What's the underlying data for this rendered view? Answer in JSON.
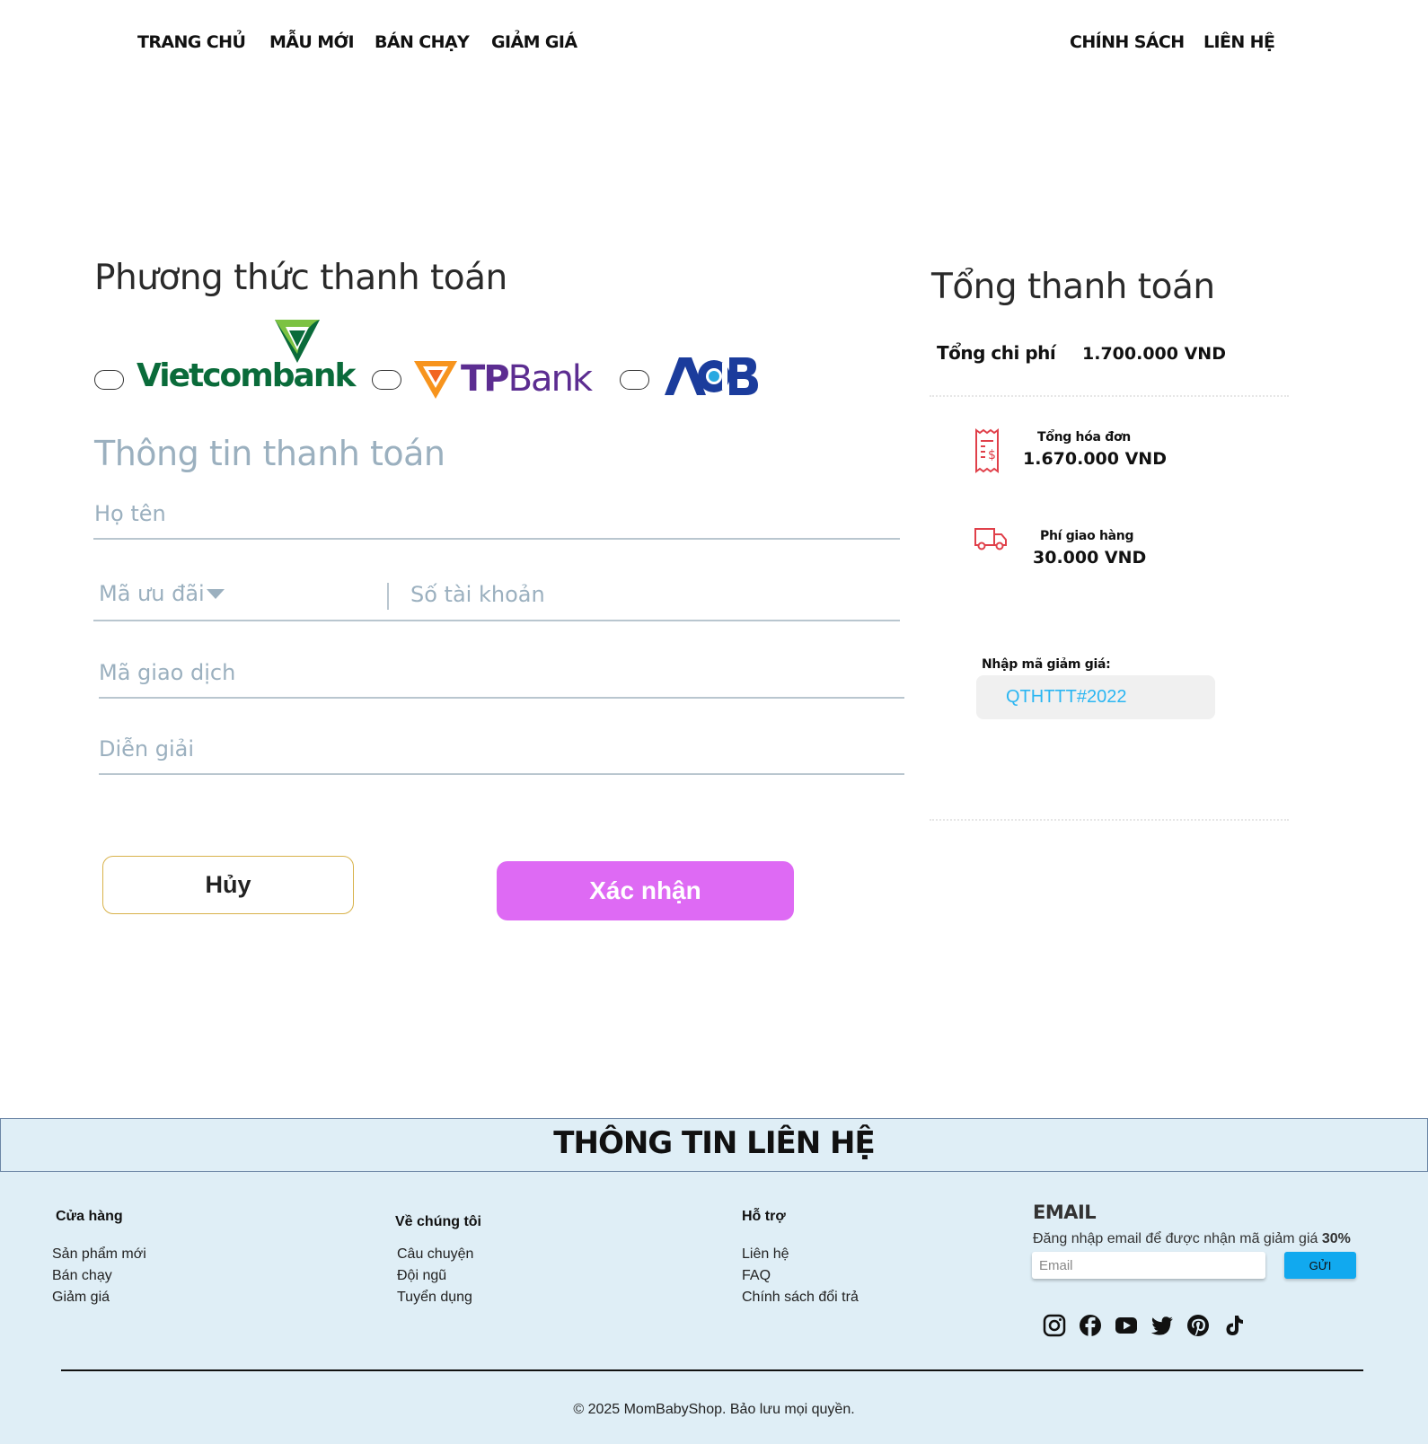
{
  "nav": {
    "home": "TRANG CHỦ",
    "new": "MẪU MỚI",
    "bestseller": "BÁN CHẠY",
    "sale": "GIẢM GIÁ",
    "policy": "CHÍNH SÁCH",
    "contact": "LIÊN HỆ"
  },
  "payment": {
    "title": "Phương thức thanh toán",
    "banks": [
      {
        "name": "Vietcombank",
        "icon": "vietcombank-logo",
        "color": "#0a6b3a"
      },
      {
        "name_prefix": "TP",
        "name_suffix": "Bank",
        "icon": "tpbank-logo",
        "color": "#5c2d91"
      },
      {
        "name": "ACB",
        "icon": "acb-logo",
        "color": "#1b3c9c"
      }
    ]
  },
  "info": {
    "title": "Thông tin thanh toán",
    "fullname_placeholder": "Họ tên",
    "promo_placeholder": "Mã ưu đãi",
    "account_placeholder": "Số tài khoản",
    "transaction_placeholder": "Mã giao dịch",
    "note_placeholder": "Diễn giải"
  },
  "buttons": {
    "cancel": "Hủy",
    "confirm": "Xác nhận"
  },
  "summary": {
    "title": "Tổng thanh toán",
    "total_label": "Tổng chi phí",
    "total_value": "1.700.000 VND",
    "invoice_label": "Tổng hóa đơn",
    "invoice_value": "1.670.000 VND",
    "shipping_label": "Phí giao hàng",
    "shipping_value": "30.000 VND",
    "coupon_label": "Nhập mã giảm giá:",
    "coupon_value": "QTHTTT#2022"
  },
  "footer": {
    "title": "THÔNG TIN LIÊN HỆ",
    "store": {
      "heading": "Cửa hàng",
      "links": [
        "Sản phẩm mới",
        "Bán chạy",
        "Giảm giá"
      ]
    },
    "about": {
      "heading": "Về chúng tôi",
      "links": [
        "Câu chuyện",
        "Đội ngũ",
        "Tuyển dụng"
      ]
    },
    "support": {
      "heading": "Hỗ trợ",
      "links": [
        "Liên hệ",
        "FAQ",
        "Chính sách đổi trả"
      ]
    },
    "email": {
      "heading": "EMAIL",
      "desc": "Đăng nhập email để được nhận mã giảm giá",
      "discount": "30%",
      "placeholder": "Email",
      "send": "GỬI"
    },
    "social": [
      "instagram-icon",
      "facebook-icon",
      "youtube-icon",
      "twitter-icon",
      "pinterest-icon",
      "tiktok-icon"
    ],
    "copyright": "© 2025 MomBabyShop. Bảo lưu mọi quyền."
  },
  "colors": {
    "accent": "#de6af4",
    "cancel_border": "#d8b24a",
    "footer_bg": "#dfeef6",
    "coupon_text": "#2bb6f2",
    "icon_red": "#e0404a"
  }
}
